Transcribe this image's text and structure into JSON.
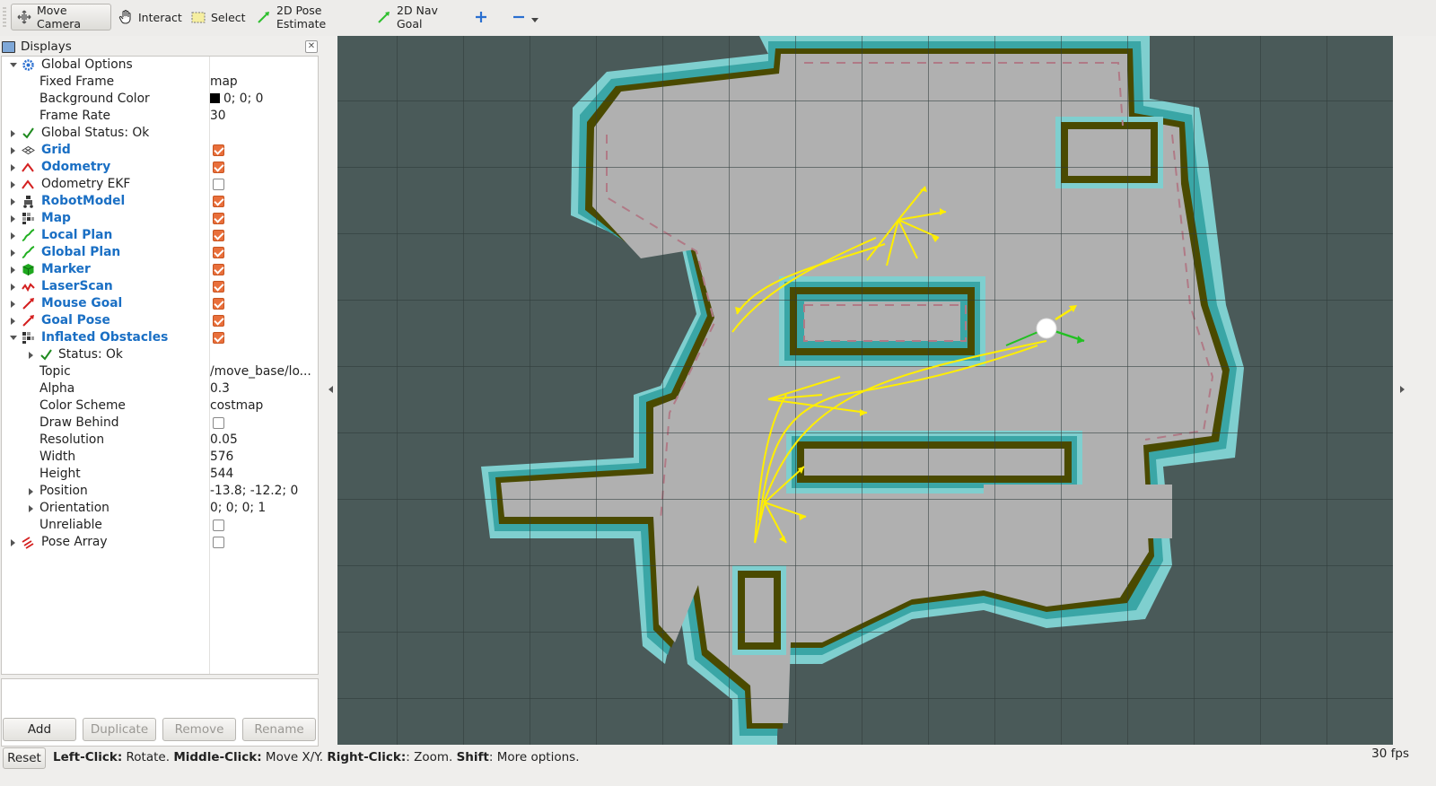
{
  "toolbar": {
    "items": [
      {
        "label": "Move Camera",
        "icon": "move-camera-icon",
        "active": true
      },
      {
        "label": "Interact",
        "icon": "hand-icon"
      },
      {
        "label": "Select",
        "icon": "select-box-icon"
      },
      {
        "label": "2D Pose Estimate",
        "icon": "pose-estimate-arrow-icon",
        "color": "#2fbf2f"
      },
      {
        "label": "2D Nav Goal",
        "icon": "nav-goal-arrow-icon",
        "color": "#2fbf2f"
      }
    ]
  },
  "displays_panel": {
    "title": "Displays",
    "rows": [
      {
        "name": "Global Options",
        "value": ""
      },
      {
        "name": "Fixed Frame",
        "value": "map"
      },
      {
        "name": "Background Color",
        "value": "0; 0; 0"
      },
      {
        "name": "Frame Rate",
        "value": "30"
      },
      {
        "name": "Global Status: Ok",
        "value": ""
      },
      {
        "name": "Grid",
        "checked": true
      },
      {
        "name": "Odometry",
        "checked": true
      },
      {
        "name": "Odometry EKF",
        "checked": false
      },
      {
        "name": "RobotModel",
        "checked": true
      },
      {
        "name": "Map",
        "checked": true
      },
      {
        "name": "Local Plan",
        "checked": true
      },
      {
        "name": "Global Plan",
        "checked": true
      },
      {
        "name": "Marker",
        "checked": true
      },
      {
        "name": "LaserScan",
        "checked": true
      },
      {
        "name": "Mouse Goal",
        "checked": true
      },
      {
        "name": "Goal Pose",
        "checked": true
      },
      {
        "name": "Inflated Obstacles",
        "checked": true
      },
      {
        "name": "Status: Ok",
        "value": ""
      },
      {
        "name": "Topic",
        "value": "/move_base/lo..."
      },
      {
        "name": "Alpha",
        "value": "0.3"
      },
      {
        "name": "Color Scheme",
        "value": "costmap"
      },
      {
        "name": "Draw Behind",
        "checked": false
      },
      {
        "name": "Resolution",
        "value": "0.05"
      },
      {
        "name": "Width",
        "value": "576"
      },
      {
        "name": "Height",
        "value": "544"
      },
      {
        "name": "Position",
        "value": "-13.8; -12.2; 0"
      },
      {
        "name": "Orientation",
        "value": "0; 0; 0; 1"
      },
      {
        "name": "Unreliable",
        "checked": false
      },
      {
        "name": "Pose Array",
        "checked": false
      }
    ],
    "buttons": {
      "add": "Add",
      "duplicate": "Duplicate",
      "remove": "Remove",
      "rename": "Rename"
    }
  },
  "status_bar": {
    "reset": "Reset",
    "hint_parts": [
      {
        "bold": true,
        "text": "Left-Click:"
      },
      {
        "bold": false,
        "text": " Rotate. "
      },
      {
        "bold": true,
        "text": "Middle-Click:"
      },
      {
        "bold": false,
        "text": " Move X/Y. "
      },
      {
        "bold": true,
        "text": "Right-Click:"
      },
      {
        "bold": false,
        "text": ": Zoom. "
      },
      {
        "bold": true,
        "text": "Shift"
      },
      {
        "bold": false,
        "text": ": More options."
      }
    ],
    "fps": "30 fps"
  },
  "viewport": {
    "background": "#4a5a59",
    "free_space_color": "#b0b0b0",
    "wall_color": "#4a4a00",
    "inflation_color": "#3aa6a6",
    "inflation_outer_color": "#7fcfcf",
    "plan_color": "#ffee00",
    "robot_color": "#ffffff"
  }
}
